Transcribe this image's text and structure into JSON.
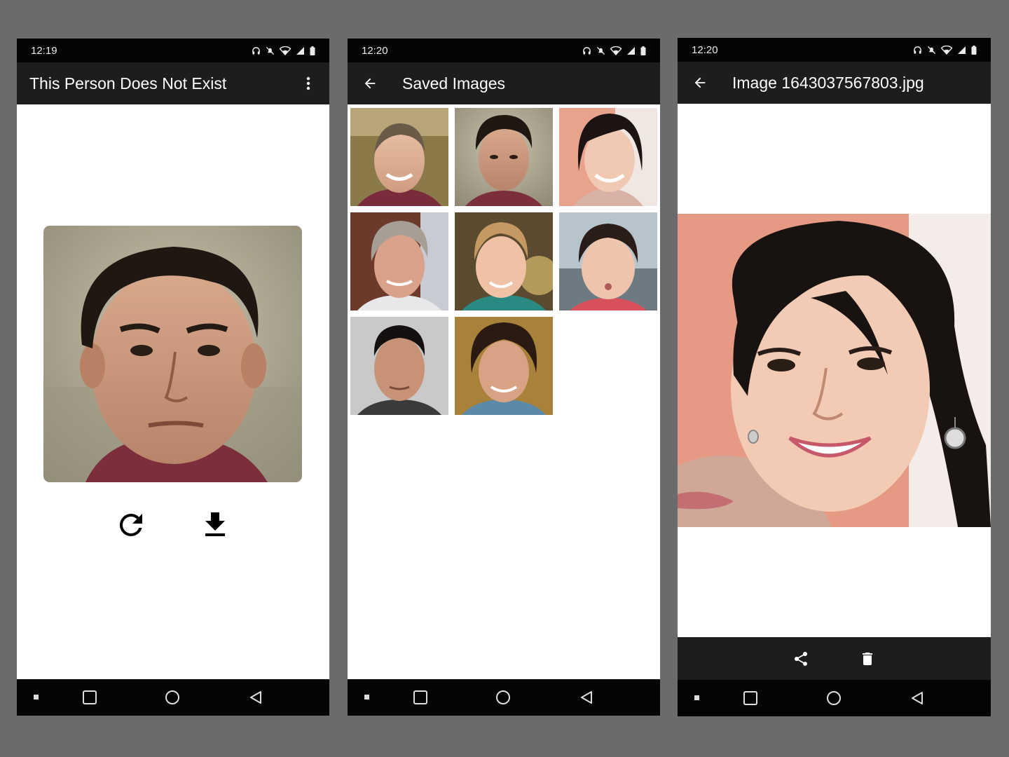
{
  "screens": [
    {
      "status": {
        "time": "12:19"
      },
      "app_bar": {
        "title": "This Person Does Not Exist"
      }
    },
    {
      "status": {
        "time": "12:20"
      },
      "app_bar": {
        "title": "Saved Images"
      },
      "thumbnail_count": 8
    },
    {
      "status": {
        "time": "12:20"
      },
      "app_bar": {
        "title": "Image 1643037567803.jpg"
      }
    }
  ],
  "icons": {
    "status": [
      "headset-icon",
      "mute-icon",
      "wifi-icon",
      "signal-icon",
      "battery-icon"
    ],
    "home_actions": [
      "refresh-icon",
      "download-icon"
    ],
    "viewer_actions": [
      "share-icon",
      "delete-icon"
    ],
    "navigation": [
      "recents-dot-icon",
      "square-icon",
      "circle-icon",
      "triangle-back-icon"
    ]
  },
  "colors": {
    "app_bar": "#1d1d1d",
    "status_bar": "#050505",
    "backdrop": "#6b6b6b"
  }
}
